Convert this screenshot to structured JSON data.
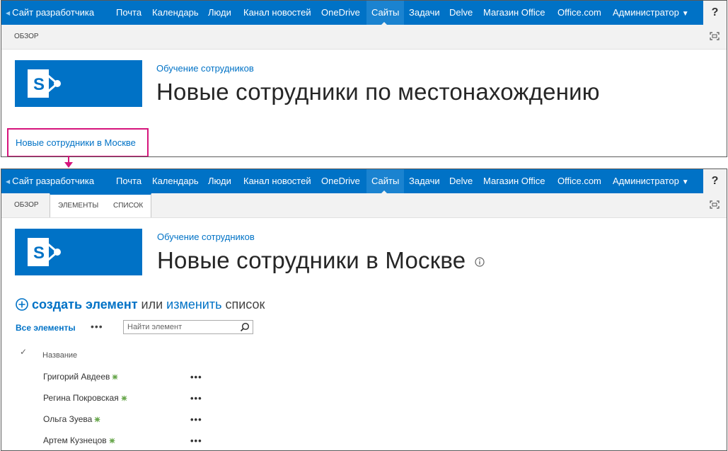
{
  "suitebar": {
    "items": [
      "Сайт разработчика",
      "Почта",
      "Календарь",
      "Люди",
      "Канал новостей",
      "OneDrive",
      "Сайты",
      "Задачи",
      "Delve",
      "Магазин Office",
      "Office.com",
      "Администратор"
    ],
    "active": "Сайты",
    "help": "?",
    "color": "#0072c6"
  },
  "panel1": {
    "ribbon_tabs": [
      "ОБЗОР"
    ],
    "breadcrumb": "Обучение сотрудников",
    "title": "Новые сотрудники по местонахождению",
    "highlighted_link": "Новые сотрудники в Москве",
    "highlight_color": "#d6157c"
  },
  "panel2": {
    "ribbon_tabs": [
      "ОБЗОР",
      "ЭЛЕМЕНТЫ",
      "СПИСОК"
    ],
    "breadcrumb": "Обучение сотрудников",
    "title": "Новые сотрудники в Москве",
    "create": {
      "new_item": "создать элемент",
      "or": "или",
      "edit": "изменить",
      "list": "список"
    },
    "view_label": "Все элементы",
    "view_more": "•••",
    "search_placeholder": "Найти элемент",
    "column_header": "Название",
    "rows": [
      {
        "name": "Григорий Авдеев",
        "more": "•••"
      },
      {
        "name": "Регина Покровская",
        "more": "•••"
      },
      {
        "name": "Ольга Зуева",
        "more": "•••"
      },
      {
        "name": "Артем Кузнецов",
        "more": "•••"
      }
    ]
  }
}
